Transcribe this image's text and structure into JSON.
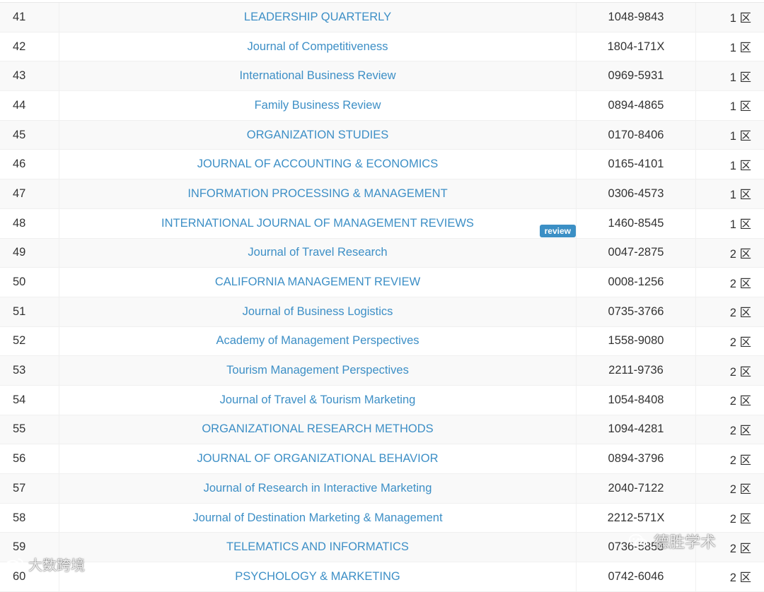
{
  "rows": [
    {
      "index": "41",
      "name": "LEADERSHIP QUARTERLY",
      "issn": "1048-9843",
      "zone": "1 区"
    },
    {
      "index": "42",
      "name": "Journal of Competitiveness",
      "issn": "1804-171X",
      "zone": "1 区"
    },
    {
      "index": "43",
      "name": "International Business Review",
      "issn": "0969-5931",
      "zone": "1 区"
    },
    {
      "index": "44",
      "name": "Family Business Review",
      "issn": "0894-4865",
      "zone": "1 区"
    },
    {
      "index": "45",
      "name": "ORGANIZATION STUDIES",
      "issn": "0170-8406",
      "zone": "1 区"
    },
    {
      "index": "46",
      "name": "JOURNAL OF ACCOUNTING & ECONOMICS",
      "issn": "0165-4101",
      "zone": "1 区"
    },
    {
      "index": "47",
      "name": "INFORMATION PROCESSING & MANAGEMENT",
      "issn": "0306-4573",
      "zone": "1 区"
    },
    {
      "index": "48",
      "name": "INTERNATIONAL JOURNAL OF MANAGEMENT REVIEWS",
      "issn": "1460-8545",
      "zone": "1 区",
      "badge": "review"
    },
    {
      "index": "49",
      "name": "Journal of Travel Research",
      "issn": "0047-2875",
      "zone": "2 区"
    },
    {
      "index": "50",
      "name": "CALIFORNIA MANAGEMENT REVIEW",
      "issn": "0008-1256",
      "zone": "2 区"
    },
    {
      "index": "51",
      "name": "Journal of Business Logistics",
      "issn": "0735-3766",
      "zone": "2 区"
    },
    {
      "index": "52",
      "name": "Academy of Management Perspectives",
      "issn": "1558-9080",
      "zone": "2 区"
    },
    {
      "index": "53",
      "name": "Tourism Management Perspectives",
      "issn": "2211-9736",
      "zone": "2 区"
    },
    {
      "index": "54",
      "name": "Journal of Travel & Tourism Marketing",
      "issn": "1054-8408",
      "zone": "2 区"
    },
    {
      "index": "55",
      "name": "ORGANIZATIONAL RESEARCH METHODS",
      "issn": "1094-4281",
      "zone": "2 区"
    },
    {
      "index": "56",
      "name": "JOURNAL OF ORGANIZATIONAL BEHAVIOR",
      "issn": "0894-3796",
      "zone": "2 区"
    },
    {
      "index": "57",
      "name": "Journal of Research in Interactive Marketing",
      "issn": "2040-7122",
      "zone": "2 区"
    },
    {
      "index": "58",
      "name": "Journal of Destination Marketing & Management",
      "issn": "2212-571X",
      "zone": "2 区"
    },
    {
      "index": "59",
      "name": "TELEMATICS AND INFORMATICS",
      "issn": "0736-5853",
      "zone": "2 区"
    },
    {
      "index": "60",
      "name": "PSYCHOLOGY & MARKETING",
      "issn": "0742-6046",
      "zone": "2 区"
    }
  ],
  "watermarks": {
    "left": "大数跨境",
    "right": "德胜学术"
  },
  "colors": {
    "link": "#3d8fc6",
    "badge": "#3b8fc5",
    "text": "#333333"
  }
}
